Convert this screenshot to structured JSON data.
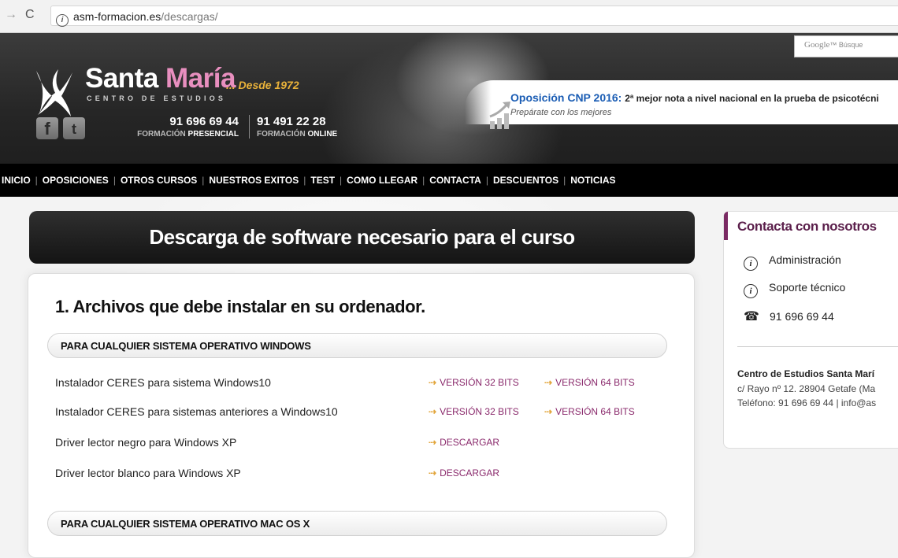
{
  "browser": {
    "url_host": "asm-formacion.es",
    "url_path": "/descargas/"
  },
  "header": {
    "brand_name_white": "Santa",
    "brand_name_pink": "María",
    "brand_sub": "CENTRO DE ESTUDIOS",
    "brand_since": "... Desde 1972",
    "phone_presencial": "91 696 69 44",
    "phone_presencial_label_a": "FORMACIÓN",
    "phone_presencial_label_b": "PRESENCIAL",
    "phone_online": "91 491 22 28",
    "phone_online_label_a": "FORMACIÓN",
    "phone_online_label_b": "ONLINE",
    "search_brand": "Google",
    "search_placeholder": "Búsque",
    "news_title": "Oposición CNP 2016:",
    "news_text": "2ª mejor nota a nivel nacional en la prueba de psicotécni",
    "news_sub": "Prepárate con los mejores"
  },
  "nav": {
    "items": [
      "INICIO",
      "OPOSICIONES",
      "OTROS CURSOS",
      "NUESTROS EXITOS",
      "TEST",
      "COMO LLEGAR",
      "CONTACTA",
      "DESCUENTOS",
      "NOTICIAS"
    ]
  },
  "main": {
    "page_title": "Descarga de software necesario para el curso",
    "section_title": "1. Archivos que debe instalar en su ordenador.",
    "group_windows": "PARA CUALQUIER SISTEMA OPERATIVO WINDOWS",
    "group_mac": "PARA CUALQUIER SISTEMA OPERATIVO MAC OS X",
    "rows": [
      {
        "name": "Instalador CERES para sistema Windows10",
        "link1": "VERSIÓN 32 BITS",
        "link2": "VERSIÓN 64 BITS"
      },
      {
        "name": "Instalador CERES para sistemas anteriores a Windows10",
        "link1": "VERSIÓN 32 BITS",
        "link2": "VERSIÓN 64 BITS"
      },
      {
        "name": "Driver lector negro para Windows XP",
        "link1": "DESCARGAR"
      },
      {
        "name": "Driver lector blanco para Windows XP",
        "link1": "DESCARGAR"
      }
    ],
    "link_arrow": "⇢"
  },
  "sidebar": {
    "title": "Contacta con nosotros",
    "items": [
      "Administración",
      "Soporte técnico",
      "91 696 69 44"
    ],
    "org": "Centro de Estudios Santa Marí",
    "address": "c/ Rayo nº 12. 28904 Getafe (Ma",
    "contact": "Teléfono: 91 696 69 44 | info@as"
  },
  "colors": {
    "brand_pink": "#e88fbf",
    "brand_gold": "#e9b23a",
    "link_purple": "#8a2a6c",
    "news_blue": "#1b5db4",
    "sidebar_accent": "#7a2a63"
  }
}
